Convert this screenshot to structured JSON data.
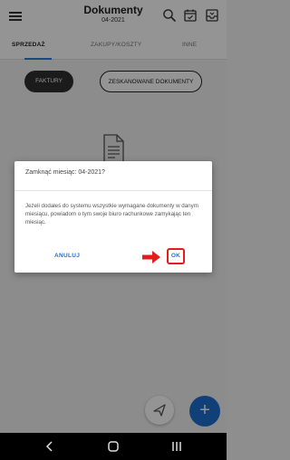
{
  "header": {
    "title": "Dokumenty",
    "subtitle": "04-2021",
    "icons": [
      "menu-icon",
      "search-icon",
      "calendar-check-icon",
      "inbox-icon"
    ]
  },
  "tabs": [
    {
      "label": "SPRZEDAŻ",
      "active": true
    },
    {
      "label": "ZAKUPY/KOSZTY",
      "active": false
    },
    {
      "label": "INNE",
      "active": false
    }
  ],
  "chips": [
    {
      "label": "FAKTURY",
      "active": true
    },
    {
      "label": "ZESKANOWANE DOKUMENTY",
      "active": false
    }
  ],
  "dialog": {
    "title": "Zamknąć miesiąc: 04-2021?",
    "body": "Jeżeli dodałeś do systemu wszystkie wymagane dokumenty w danym miesiącu, powiadom o tym swoje biuro rachunkowe zamykając ten miesiąc.",
    "cancel_label": "ANULUJ",
    "ok_label": "OK"
  },
  "colors": {
    "accent": "#1e6fd1",
    "highlight": "#e11d1d"
  },
  "navbar": {
    "icons": [
      "back-icon",
      "home-icon",
      "recents-icon"
    ]
  }
}
